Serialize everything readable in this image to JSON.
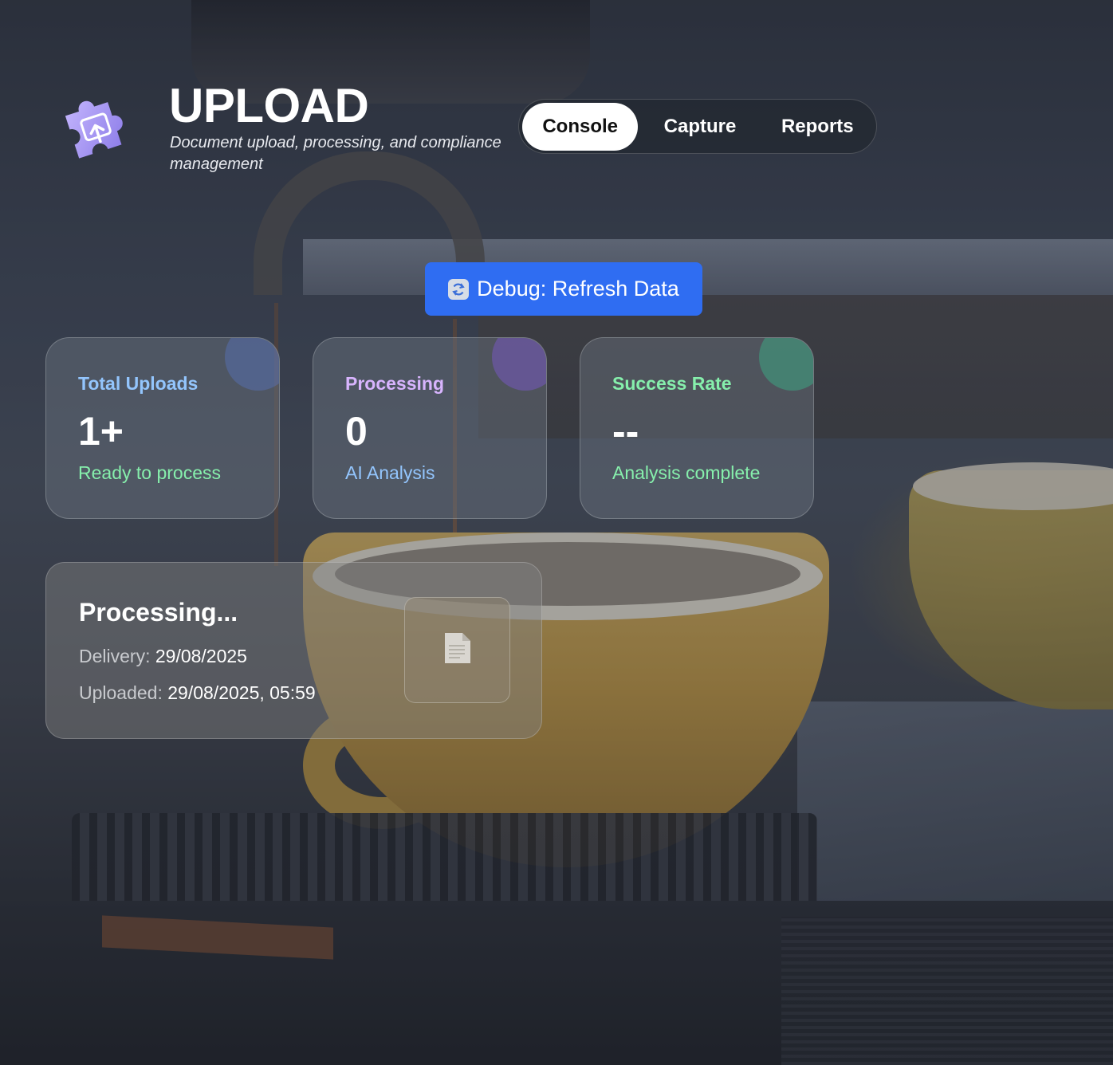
{
  "header": {
    "title": "UPLOAD",
    "subtitle": "Document upload, processing, and compliance management",
    "logo_icon": "puzzle-upload-icon"
  },
  "tabs": [
    {
      "label": "Console",
      "active": true
    },
    {
      "label": "Capture",
      "active": false
    },
    {
      "label": "Reports",
      "active": false
    }
  ],
  "debug_button": {
    "label": "Debug: Refresh Data",
    "icon": "refresh-icon"
  },
  "stats": [
    {
      "label": "Total Uploads",
      "value": "1+",
      "sub": "Ready to process",
      "label_color": "#93c5fd",
      "sub_color": "#86efac"
    },
    {
      "label": "Processing",
      "value": "0",
      "sub": "AI Analysis",
      "label_color": "#d8b4fe",
      "sub_color": "#93c5fd"
    },
    {
      "label": "Success Rate",
      "value": "--",
      "sub": "Analysis complete",
      "label_color": "#86efac",
      "sub_color": "#86efac"
    }
  ],
  "upload_card": {
    "title": "Processing...",
    "delivery_label": "Delivery:",
    "delivery_value": "29/08/2025",
    "uploaded_label": "Uploaded:",
    "uploaded_value": "29/08/2025, 05:59",
    "thumbnail_icon": "document-icon"
  },
  "colors": {
    "accent_blue": "#2f6df2",
    "glow_blue": "#5b7bd6",
    "glow_purple": "#8b5cf6",
    "glow_green": "#34d399"
  }
}
